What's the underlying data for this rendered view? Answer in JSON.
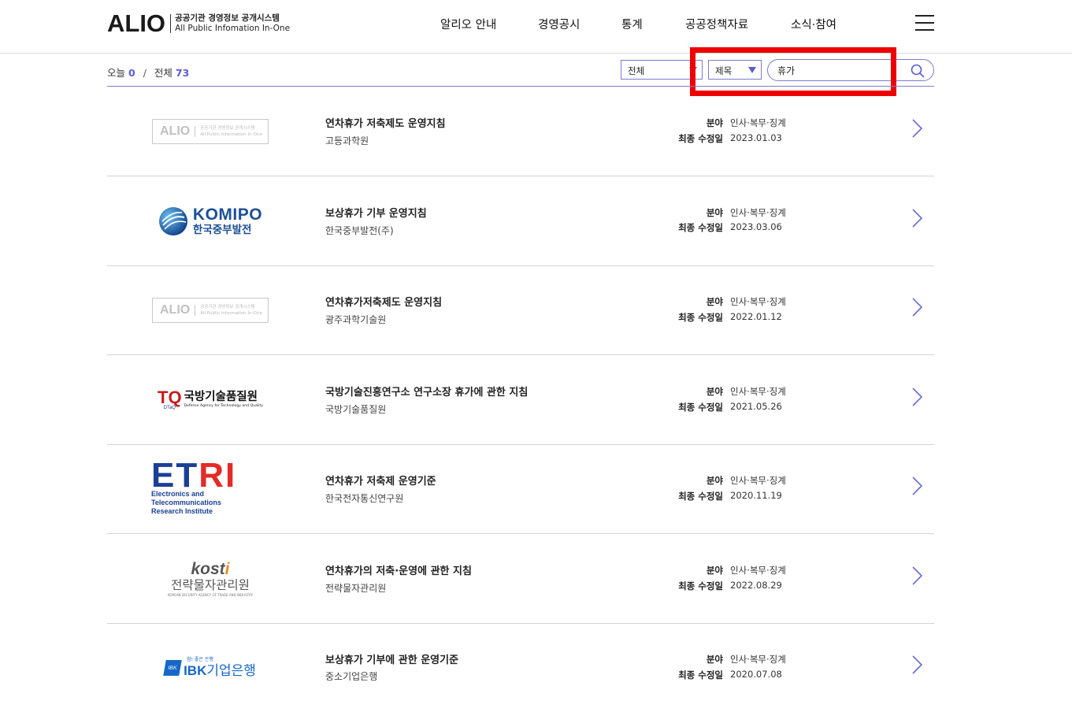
{
  "header": {
    "logo_main": "ALIO",
    "logo_sub_ko": "공공기관 경영정보 공개시스템",
    "logo_sub_en": "All Public Infomation In-One",
    "nav": [
      "알리오 안내",
      "경영공시",
      "통계",
      "공공정책자료",
      "소식·참여"
    ]
  },
  "toolbar": {
    "today_label": "오늘",
    "today_count": "0",
    "slash": "/",
    "total_label": "전체",
    "total_count": "73",
    "scope_select": "전체",
    "field_select": "제목",
    "search_value": "휴가"
  },
  "list_meta": {
    "field_label": "분야",
    "date_label": "최종 수정일"
  },
  "items": [
    {
      "title": "연차휴가 저축제도 운영지침",
      "org": "고등과학원",
      "field": "인사·복무·징계",
      "date": "2023.01.03",
      "logo": "alio-placeholder"
    },
    {
      "title": "보상휴가 기부 운영지침",
      "org": "한국중부발전(주)",
      "field": "인사·복무·징계",
      "date": "2023.03.06",
      "logo": "komipo"
    },
    {
      "title": "연차휴가저축제도 운영지침",
      "org": "광주과학기술원",
      "field": "인사·복무·징계",
      "date": "2022.01.12",
      "logo": "alio-placeholder"
    },
    {
      "title": "국방기술진흥연구소 연구소장 휴가에 관한 지침",
      "org": "국방기술품질원",
      "field": "인사·복무·징계",
      "date": "2021.05.26",
      "logo": "dtaq"
    },
    {
      "title": "연차휴가 저축제 운영기준",
      "org": "한국전자통신연구원",
      "field": "인사·복무·징계",
      "date": "2020.11.19",
      "logo": "etri"
    },
    {
      "title": "연차휴가의 저축·운영에 관한 지침",
      "org": "전략물자관리원",
      "field": "인사·복무·징계",
      "date": "2022.08.29",
      "logo": "kosti"
    },
    {
      "title": "보상휴가 기부에 관한 운영기준",
      "org": "중소기업은행",
      "field": "인사·복무·징계",
      "date": "2020.07.08",
      "logo": "ibk"
    }
  ],
  "logos": {
    "alio_placeholder": {
      "main": "ALIO",
      "ko": "공공기관 경영정보 공개시스템",
      "en": "All Public Information In-One"
    },
    "komipo": {
      "en": "KOMIPO",
      "ko": "한국중부발전"
    },
    "dtaq": {
      "mark": "TQ",
      "ko": "국방기술품질원",
      "en": "Defense Agency for Technology and Quality",
      "sub": "DTaQ"
    },
    "etri": {
      "en_main": "ETRI",
      "line1": "Electronics and Telecommunications",
      "line2": "Research Institute"
    },
    "kosti": {
      "en": "kosti",
      "ko": "전략물자관리원",
      "tiny": "KOREAN SECURITY AGENCY OF TRADE AND INDUSTRY"
    },
    "ibk": {
      "tag": "참! 좋은 은행",
      "mark": "IBK",
      "name_en": "IBK",
      "name_ko": "기업은행"
    }
  },
  "colors": {
    "accent": "#5b5bd6",
    "highlight": "#ee0000",
    "divider": "#d4d4d4"
  }
}
